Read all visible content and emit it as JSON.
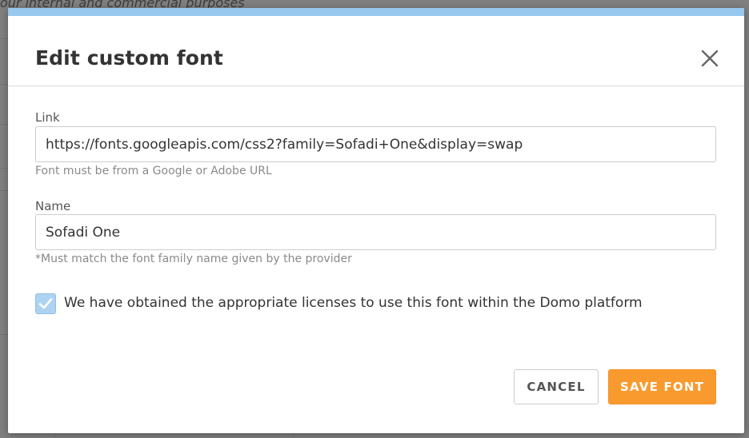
{
  "background": {
    "partial_text": "our internal and commercial purposes"
  },
  "modal": {
    "title": "Edit custom font",
    "close_icon": "close-icon",
    "link": {
      "label": "Link",
      "value": "https://fonts.googleapis.com/css2?family=Sofadi+One&display=swap",
      "help": "Font must be from a Google or Adobe URL"
    },
    "name": {
      "label": "Name",
      "value": "Sofadi One",
      "help": "*Must match the font family name given by the provider"
    },
    "license": {
      "checked": true,
      "label": "We have obtained the appropriate licenses to use this font within the Domo platform"
    },
    "buttons": {
      "cancel": "CANCEL",
      "save": "SAVE FONT"
    }
  },
  "colors": {
    "accent": "#f99a2e",
    "topbar": "#99c8ee",
    "checkbox": "#aed3f2"
  }
}
